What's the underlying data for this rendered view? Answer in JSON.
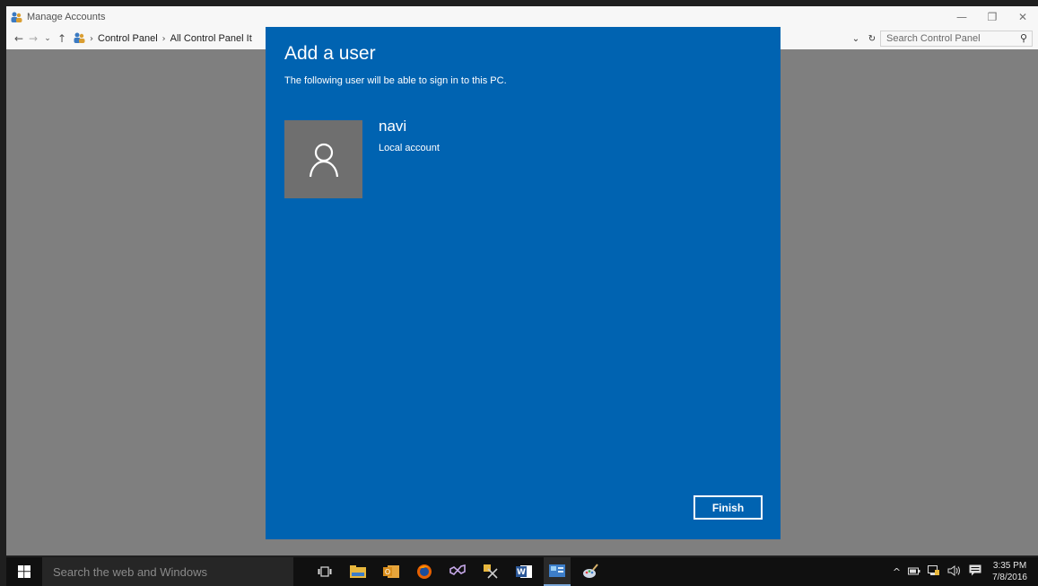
{
  "window": {
    "title": "Manage Accounts",
    "controls": {
      "minimize": "—",
      "restore": "❐",
      "close": "✕"
    }
  },
  "addressbar": {
    "back": "←",
    "forward": "→",
    "recent": "⌄",
    "up": "↑",
    "breadcrumbs": [
      "Control Panel",
      "All Control Panel It"
    ],
    "dropdown": "⌄",
    "refresh": "↻",
    "search_placeholder": "Search Control Panel"
  },
  "dialog": {
    "title": "Add a user",
    "subtitle": "The following user will be able to sign in to this PC.",
    "user": {
      "name": "navi",
      "account_type": "Local account"
    },
    "finish_label": "Finish"
  },
  "taskbar": {
    "search_placeholder": "Search the web and Windows",
    "apps": [
      "task-view",
      "file-explorer",
      "outlook",
      "firefox",
      "visual-studio",
      "snipping-tool",
      "word",
      "control-panel",
      "paint"
    ],
    "tray": {
      "chevron": "^",
      "time": "3:35 PM",
      "date": "7/8/2016"
    }
  },
  "colors": {
    "dialog_bg": "#0063b1",
    "shade": "#7f7f7f",
    "taskbar": "#101010",
    "user_tile": "#6f6f6f"
  }
}
